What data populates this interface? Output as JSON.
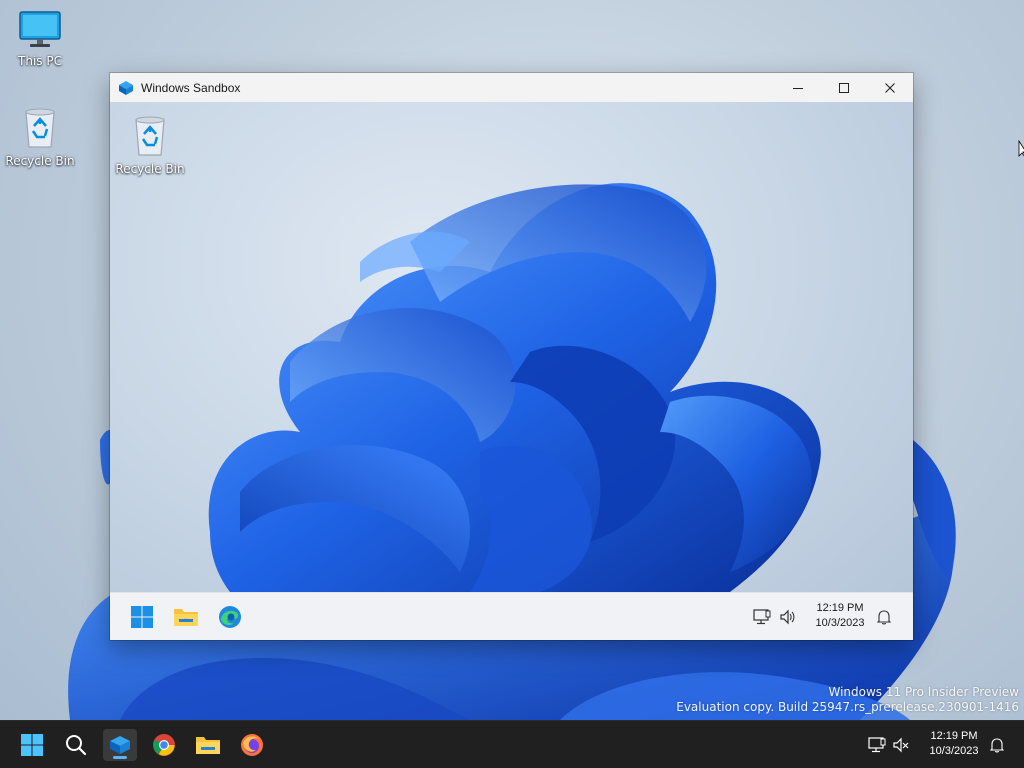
{
  "host": {
    "desktop_icons": [
      {
        "label": "This PC",
        "icon": "monitor-icon"
      },
      {
        "label": "Recycle Bin",
        "icon": "recycle-bin-icon"
      }
    ],
    "watermark": {
      "line1": "Windows 11 Pro Insider Preview",
      "line2": "Evaluation copy. Build 25947.rs_prerelease.230901-1416"
    },
    "taskbar": {
      "apps": [
        {
          "name": "Start",
          "icon": "windows-start-icon"
        },
        {
          "name": "Search",
          "icon": "search-icon"
        },
        {
          "name": "Windows Sandbox",
          "icon": "sandbox-icon",
          "active": true
        },
        {
          "name": "Chrome",
          "icon": "chrome-icon"
        },
        {
          "name": "File Explorer",
          "icon": "folder-icon"
        },
        {
          "name": "Firefox",
          "icon": "firefox-icon"
        }
      ],
      "clock": {
        "time": "12:19 PM",
        "date": "10/3/2023"
      },
      "tray_icons": [
        "network-icon",
        "volume-muted-icon",
        "notification-bell-icon"
      ]
    }
  },
  "sandbox": {
    "title": "Windows Sandbox",
    "controls": [
      "minimize-icon",
      "maximize-icon",
      "close-icon"
    ],
    "desktop_icons": [
      {
        "label": "Recycle Bin",
        "icon": "recycle-bin-icon"
      }
    ],
    "taskbar": {
      "apps": [
        "windows-start-icon",
        "folder-icon",
        "edge-icon"
      ],
      "clock": {
        "time": "12:19 PM",
        "date": "10/3/2023"
      },
      "tray_icons": [
        "network-icon",
        "volume-icon",
        "notification-bell-icon"
      ]
    }
  },
  "colors": {
    "accent": "#0078d4",
    "bloom_dark": "#0b3fb8",
    "bloom_light": "#3d8bff",
    "taskbar_dark": "#202020"
  }
}
